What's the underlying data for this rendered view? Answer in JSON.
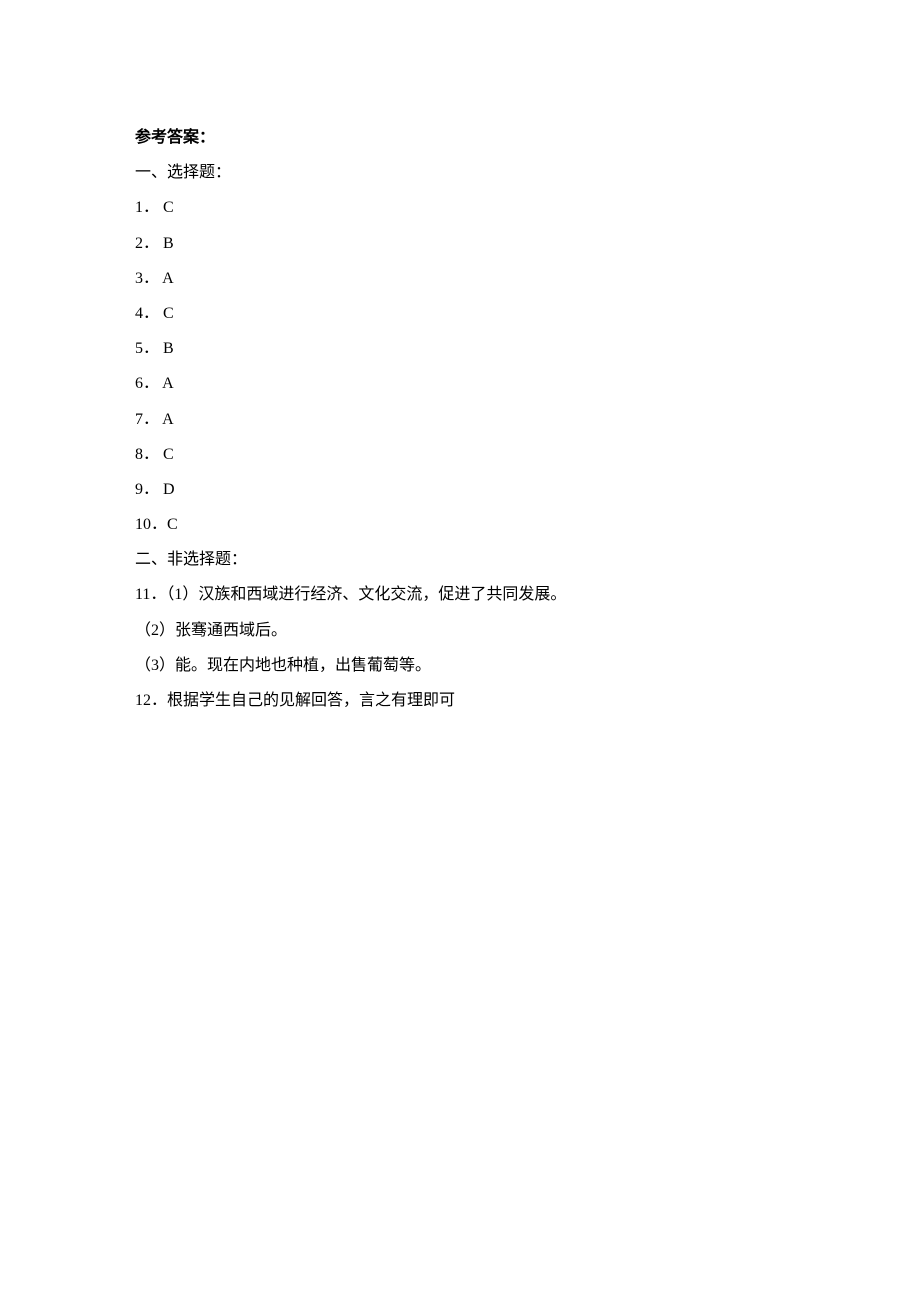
{
  "title": "参考答案：",
  "section1_heading": "一、选择题：",
  "mc": [
    {
      "num": "1．",
      "ans": "C"
    },
    {
      "num": "2．",
      "ans": "B"
    },
    {
      "num": "3．",
      "ans": "A"
    },
    {
      "num": "4．",
      "ans": "C"
    },
    {
      "num": "5．",
      "ans": "B"
    },
    {
      "num": "6．",
      "ans": "A"
    },
    {
      "num": "7．",
      "ans": "A"
    },
    {
      "num": "8．",
      "ans": "C"
    },
    {
      "num": "9．",
      "ans": "D"
    },
    {
      "num": "10．",
      "ans": "C"
    }
  ],
  "section2_heading": "二、非选择题：",
  "q11_line1": "11．（1）汉族和西域进行经济、文化交流，促进了共同发展。",
  "q11_line2": "（2）张骞通西域后。",
  "q11_line3": "（3）能。现在内地也种植，出售葡萄等。",
  "q12": "12．根据学生自己的见解回答，言之有理即可"
}
